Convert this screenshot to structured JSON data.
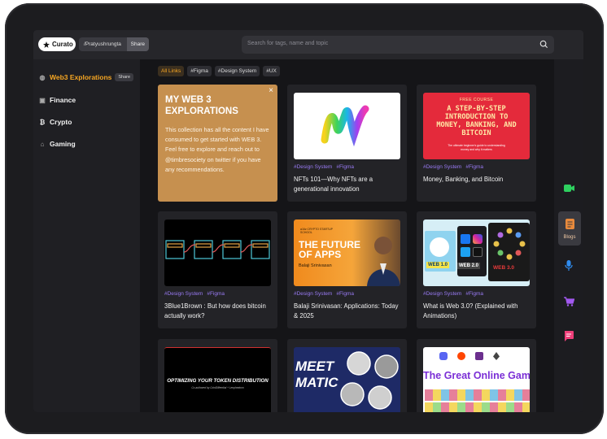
{
  "topbar": {
    "logo_label": "Curato",
    "url": "/Pratyushrungta",
    "share_label": "Share",
    "search_placeholder": "Search for tags, name and topic"
  },
  "sidebar": {
    "items": [
      {
        "label": "Web3 Explorations",
        "share": "Share",
        "icon": "globe-icon"
      },
      {
        "label": "Finance",
        "icon": "money-icon"
      },
      {
        "label": "Crypto",
        "icon": "bitcoin-icon"
      },
      {
        "label": "Gaming",
        "icon": "gamepad-icon"
      }
    ]
  },
  "tags": [
    "All Links",
    "#Figma",
    "#Design System",
    "#UX"
  ],
  "info_card": {
    "title": "MY WEB 3 EXPLORATIONS",
    "description": "This collection has all the content I have consumed to get started with WEB 3. Feel free to explore and reach out to @timbresociety on twitter if you have any recommendations.",
    "close": "×"
  },
  "cards": [
    {
      "tags": [
        "#Design System",
        "#Figma"
      ],
      "title": "NFTs 101—Why NFTs are a generational innovation"
    },
    {
      "tags": [
        "#Design System",
        "#Figma"
      ],
      "title": "Money, Banking, and Bitcoin",
      "thumb": {
        "kicker": "FREE COURSE",
        "headline": "A STEP-BY-STEP INTRODUCTION TO MONEY, BANKING, AND BITCOIN",
        "sub": "The ultimate beginner's guide to understanding money and why it matters"
      }
    },
    {
      "tags": [
        "#Design System",
        "#Figma"
      ],
      "title": "3Blue1Brown : But how does bitcoin actually work?"
    },
    {
      "tags": [
        "#Design System",
        "#Figma"
      ],
      "title": "Balaji Srinivasan: Applications: Today & 2025",
      "thumb": {
        "kicker": "a16z CRYPTO STARTUP SCHOOL",
        "headline": "THE FUTURE OF APPS",
        "sub": "Balaji Srinivasan"
      }
    },
    {
      "tags": [
        "#Design System",
        "#Figma"
      ],
      "title": "What is Web 3.0? (Explained with Animations)",
      "thumb": {
        "l1": "WEB 1.0",
        "l2": "WEB 2.0",
        "l3": "WEB 3.0"
      }
    },
    {
      "tags": [],
      "title": "",
      "thumb": {
        "headline": "OPTIMIZING YOUR TOKEN DISTRIBUTION",
        "sub": "Co-authored by CoinDifferntial + Leopheatom"
      }
    },
    {
      "tags": [],
      "title": "",
      "thumb": {
        "headline": "MEET MATIC"
      }
    },
    {
      "tags": [],
      "title": "",
      "thumb": {
        "headline": "The Great Online Gam"
      }
    }
  ],
  "rail": {
    "blogs_label": "Blogs"
  },
  "colors": {
    "accent": "#f6a623",
    "tag": "#9a7bf5",
    "info_card": "#c6904f"
  }
}
